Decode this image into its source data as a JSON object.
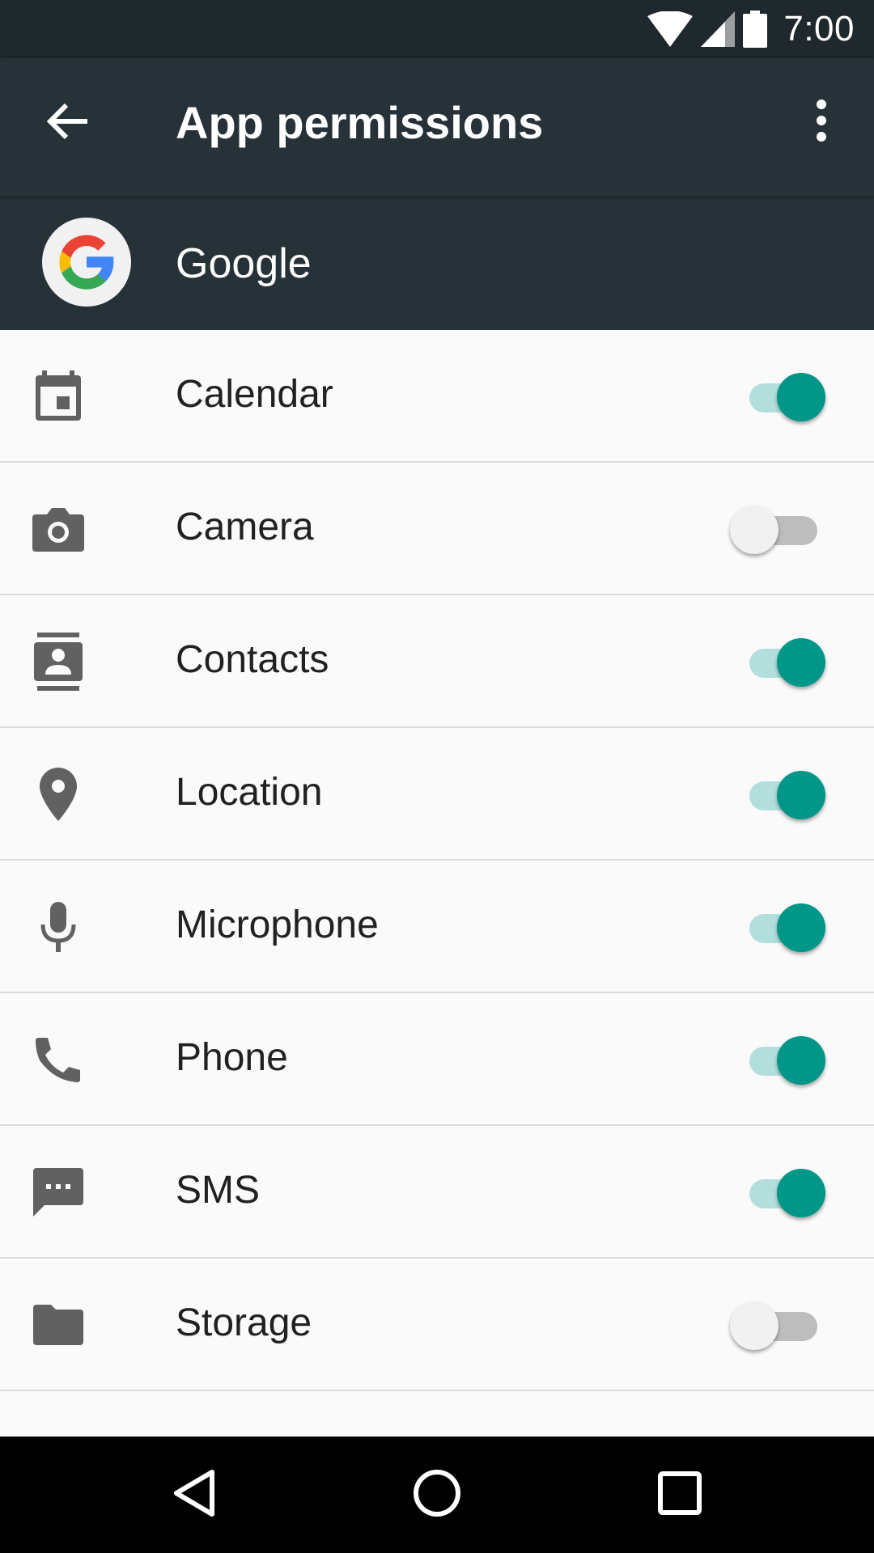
{
  "status_bar": {
    "time": "7:00",
    "icons": [
      "wifi-icon",
      "cell-signal-icon",
      "battery-icon"
    ]
  },
  "app_bar": {
    "title": "App permissions",
    "back_icon": "arrow-back-icon",
    "overflow_icon": "more-vert-icon"
  },
  "app_header": {
    "app_name": "Google",
    "app_icon": "google-logo"
  },
  "permissions": [
    {
      "label": "Calendar",
      "icon": "calendar-icon",
      "enabled": true
    },
    {
      "label": "Camera",
      "icon": "camera-icon",
      "enabled": false
    },
    {
      "label": "Contacts",
      "icon": "contacts-icon",
      "enabled": true
    },
    {
      "label": "Location",
      "icon": "location-pin-icon",
      "enabled": true
    },
    {
      "label": "Microphone",
      "icon": "microphone-icon",
      "enabled": true
    },
    {
      "label": "Phone",
      "icon": "phone-icon",
      "enabled": true
    },
    {
      "label": "SMS",
      "icon": "sms-icon",
      "enabled": true
    },
    {
      "label": "Storage",
      "icon": "folder-icon",
      "enabled": false
    }
  ],
  "nav_bar": {
    "buttons": [
      "back-triangle-icon",
      "home-circle-icon",
      "recents-square-icon"
    ]
  },
  "colors": {
    "toolbar": "#263238",
    "status_bar": "#1f282d",
    "accent": "#009688",
    "accent_track": "#b2dfdb",
    "icon_gray": "#616161"
  }
}
